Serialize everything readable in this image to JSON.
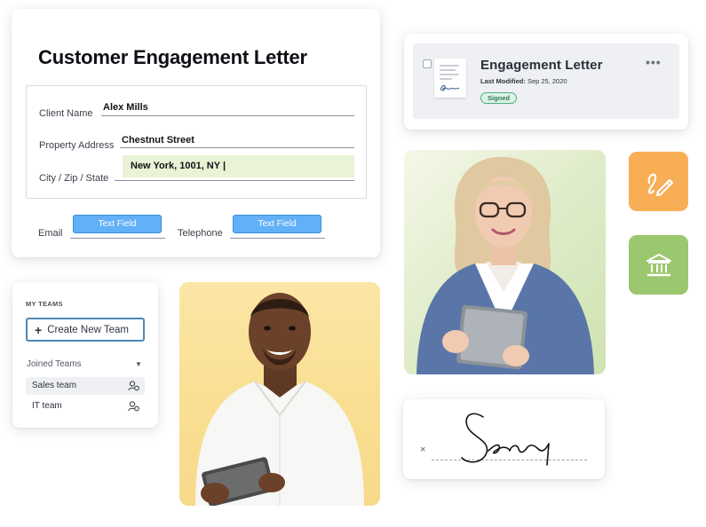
{
  "form": {
    "title": "Customer Engagement Letter",
    "client_name_label": "Client Name",
    "client_name_value": "Alex Mills",
    "property_address_label": "Property Address",
    "property_address_value": "Chestnut Street",
    "city_label": "City / Zip / State",
    "city_value": "New York, 1001, NY |",
    "email_label": "Email",
    "email_field": "Text Field",
    "telephone_label": "Telephone",
    "telephone_field": "Text Field"
  },
  "letter": {
    "title": "Engagement Letter",
    "modified_label": "Last Modified:",
    "modified_date": "Sep 25, 2020",
    "status": "Signed",
    "more": "•••"
  },
  "teams": {
    "heading": "MY TEAMS",
    "create_label": "Create New Team",
    "joined_label": "Joined Teams",
    "items": [
      {
        "label": "Sales team"
      },
      {
        "label": "IT team"
      }
    ]
  },
  "signature": {
    "x_mark": "×"
  },
  "colors": {
    "sign_tile": "#f8ae55",
    "bank_tile": "#9bc76e",
    "text_field": "#62b0f7",
    "city_highlight": "#e9f3d5",
    "signed_badge": "#4cae7f",
    "man_backdrop": "#fbe6a6",
    "woman_backdrop": "#dcebc6"
  },
  "icons": {
    "sign_tile": "signature-pen-icon",
    "bank_tile": "bank-icon",
    "team_row": "team-members-icon",
    "create": "plus-icon",
    "joined": "caret-down-icon"
  }
}
